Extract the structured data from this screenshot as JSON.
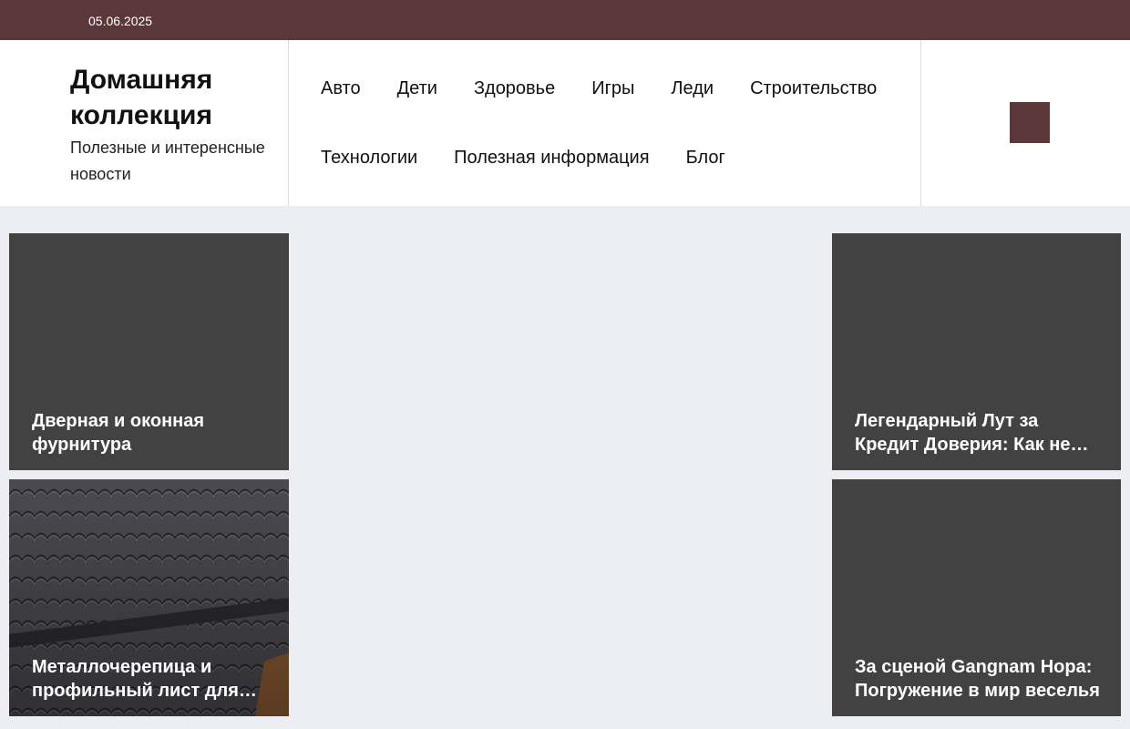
{
  "topbar": {
    "date": "05.06.2025"
  },
  "header": {
    "site_title": "Домашняя коллекция",
    "site_description": "Полезные и интеренсные новости"
  },
  "nav": {
    "row1": [
      "Авто",
      "Дети",
      "Здоровье",
      "Игры",
      "Леди",
      "Строительство"
    ],
    "row2": [
      "Технологии",
      "Полезная информация",
      "Блог"
    ]
  },
  "cards": [
    {
      "title": "Дверная и оконная фурнитура"
    },
    {
      "title": "Металлочерепица и профильный лист для строительства"
    },
    {
      "title": "Легендарный Лут за Кредит Доверия: Как не потерять всё"
    },
    {
      "title": "За сценой Gangnam Нора: Погружение в мир веселья"
    }
  ],
  "colors": {
    "brand": "#5c373a",
    "page_bg": "#eceef3",
    "card_bg": "#424242"
  },
  "icons": {
    "search": "search-icon"
  }
}
